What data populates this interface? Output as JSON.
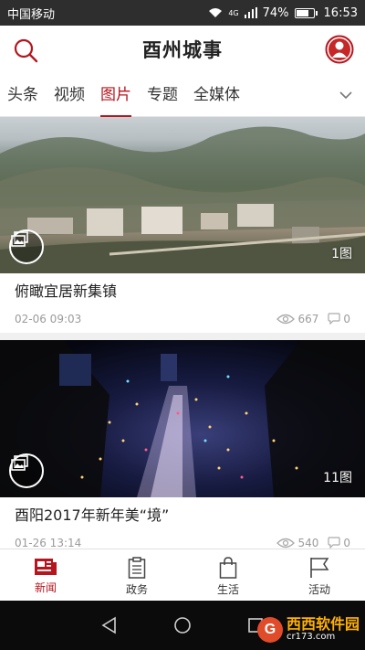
{
  "status": {
    "carrier": "中国移动",
    "network": "4G",
    "battery": "74%",
    "battery_level": 0.74,
    "time": "16:53"
  },
  "header": {
    "title": "酉州城事"
  },
  "tabs": [
    {
      "label": "头条",
      "active": false
    },
    {
      "label": "视频",
      "active": false
    },
    {
      "label": "图片",
      "active": true
    },
    {
      "label": "专题",
      "active": false
    },
    {
      "label": "全媒体",
      "active": false
    }
  ],
  "feed": [
    {
      "title": "俯瞰宜居新集镇",
      "date": "02-06 09:03",
      "views": "667",
      "comments": "0",
      "count": "1图"
    },
    {
      "title": "酉阳2017年新年美“境”",
      "date": "01-26 13:14",
      "views": "540",
      "comments": "0",
      "count": "11图"
    }
  ],
  "bottom_nav": [
    {
      "label": "新闻",
      "icon": "news-icon",
      "active": true
    },
    {
      "label": "政务",
      "icon": "clipboard-icon",
      "active": false
    },
    {
      "label": "生活",
      "icon": "shopping-bag-icon",
      "active": false
    },
    {
      "label": "活动",
      "icon": "flag-icon",
      "active": false
    }
  ],
  "watermark": {
    "logo": "G",
    "main": "西西软件园",
    "sub": "cr173.com"
  },
  "colors": {
    "accent": "#b5161e",
    "status_bar": "#2e2e2e",
    "system_nav": "#0b0b0b"
  }
}
